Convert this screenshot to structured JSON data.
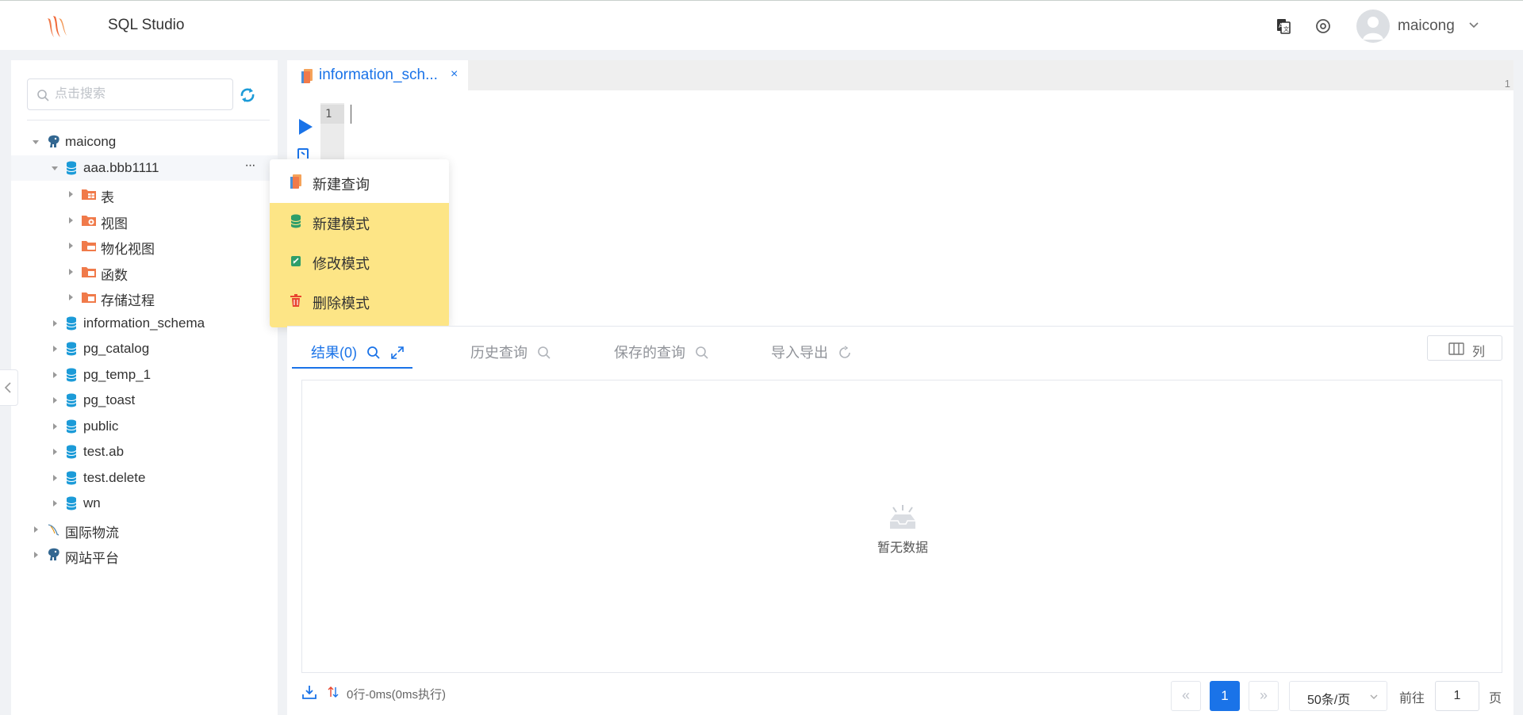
{
  "header": {
    "app_title": "SQL Studio",
    "username": "maicong"
  },
  "sidebar": {
    "search_placeholder": "点击搜索",
    "tree": [
      {
        "label": "maicong",
        "icon": "postgres-elephant-icon",
        "expanded": true
      },
      {
        "label": "aaa.bbb1111",
        "icon": "database-icon",
        "expanded": true,
        "selected": true
      },
      {
        "label": "表",
        "icon": "table-folder-icon"
      },
      {
        "label": "视图",
        "icon": "view-folder-icon"
      },
      {
        "label": "物化视图",
        "icon": "materialized-view-folder-icon"
      },
      {
        "label": "函数",
        "icon": "function-folder-icon"
      },
      {
        "label": "存储过程",
        "icon": "procedure-folder-icon"
      },
      {
        "label": "information_schema",
        "icon": "database-icon"
      },
      {
        "label": "pg_catalog",
        "icon": "database-icon"
      },
      {
        "label": "pg_temp_1",
        "icon": "database-icon"
      },
      {
        "label": "pg_toast",
        "icon": "database-icon"
      },
      {
        "label": "public",
        "icon": "database-icon"
      },
      {
        "label": "test.ab",
        "icon": "database-icon"
      },
      {
        "label": "test.delete",
        "icon": "database-icon"
      },
      {
        "label": "wn",
        "icon": "database-icon"
      },
      {
        "label": "国际物流",
        "icon": "mysql-dolphin-icon"
      },
      {
        "label": "网站平台",
        "icon": "postgres-elephant-icon"
      }
    ],
    "more_label": "···"
  },
  "editor": {
    "tab_label": "information_sch...",
    "tab_close": "×",
    "tab_count": "1",
    "line_number": "1"
  },
  "context_menu": {
    "items": [
      {
        "label": "新建查询",
        "icon": "new-query-icon"
      },
      {
        "label": "新建模式",
        "icon": "database-green-icon"
      },
      {
        "label": "修改模式",
        "icon": "edit-green-icon"
      },
      {
        "label": "删除模式",
        "icon": "trash-red-icon"
      }
    ],
    "highlight_color": "#fde586"
  },
  "results": {
    "tabs": [
      {
        "label": "结果(0)",
        "active": true
      },
      {
        "label": "历史查询"
      },
      {
        "label": "保存的查询"
      },
      {
        "label": "导入导出"
      }
    ],
    "columns_label": "列",
    "empty_text": "暂无数据",
    "status": "0行-0ms(0ms执行)"
  },
  "pagination": {
    "prev": "«",
    "current_page": "1",
    "next": "»",
    "page_size": "50条/页",
    "goto_prefix": "前往",
    "goto_value": "1",
    "goto_suffix": "页"
  },
  "colors": {
    "accent": "#1a73e8",
    "database_blue": "#1c9bd8",
    "folder_orange": "#f07a4a"
  }
}
